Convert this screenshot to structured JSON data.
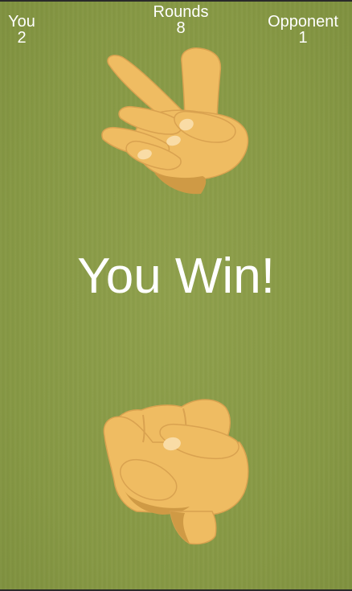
{
  "scoreboard": {
    "you": {
      "label": "You",
      "value": "2"
    },
    "rounds": {
      "label": "Rounds",
      "value": "8"
    },
    "opponent": {
      "label": "Opponent",
      "value": "1"
    }
  },
  "result_text": "You Win!",
  "opponent_hand": {
    "icon": "scissors-hand-icon"
  },
  "player_hand": {
    "icon": "rock-fist-icon"
  },
  "colors": {
    "background": "#889947",
    "skin": "#efbc62",
    "skin_shadow": "#cf9a45",
    "text": "#ffffff"
  }
}
